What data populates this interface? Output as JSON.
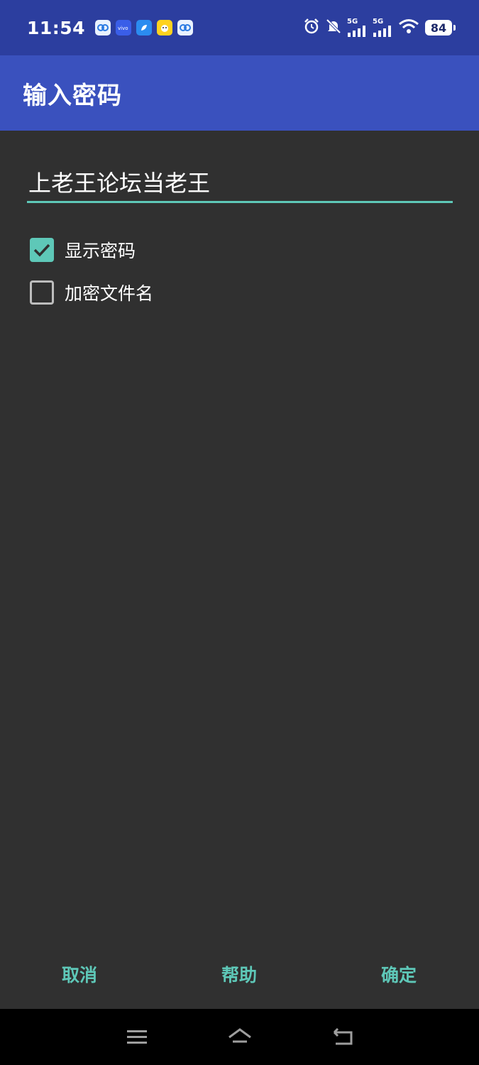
{
  "status_bar": {
    "time": "11:54",
    "signal1_label": "5G",
    "signal2_label": "5G",
    "battery": "84",
    "notification_icons": [
      "baidu-netdisk-icon",
      "vivo-icon",
      "browser-icon",
      "game-app-icon",
      "baidu-netdisk-icon"
    ]
  },
  "app_bar": {
    "title": "输入密码"
  },
  "password": {
    "value": "上老王论坛当老王"
  },
  "options": {
    "show_password": {
      "label": "显示密码",
      "checked": true
    },
    "encrypt_filename": {
      "label": "加密文件名",
      "checked": false
    }
  },
  "actions": {
    "cancel": "取消",
    "help": "帮助",
    "confirm": "确定"
  },
  "colors": {
    "status_bar": "#2c3e9f",
    "app_bar": "#3a51be",
    "background": "#303030",
    "accent": "#5ec8b8",
    "nav_bar": "#000000"
  },
  "nav_bar": {
    "icons": [
      "menu-icon",
      "home-icon",
      "back-icon"
    ]
  }
}
